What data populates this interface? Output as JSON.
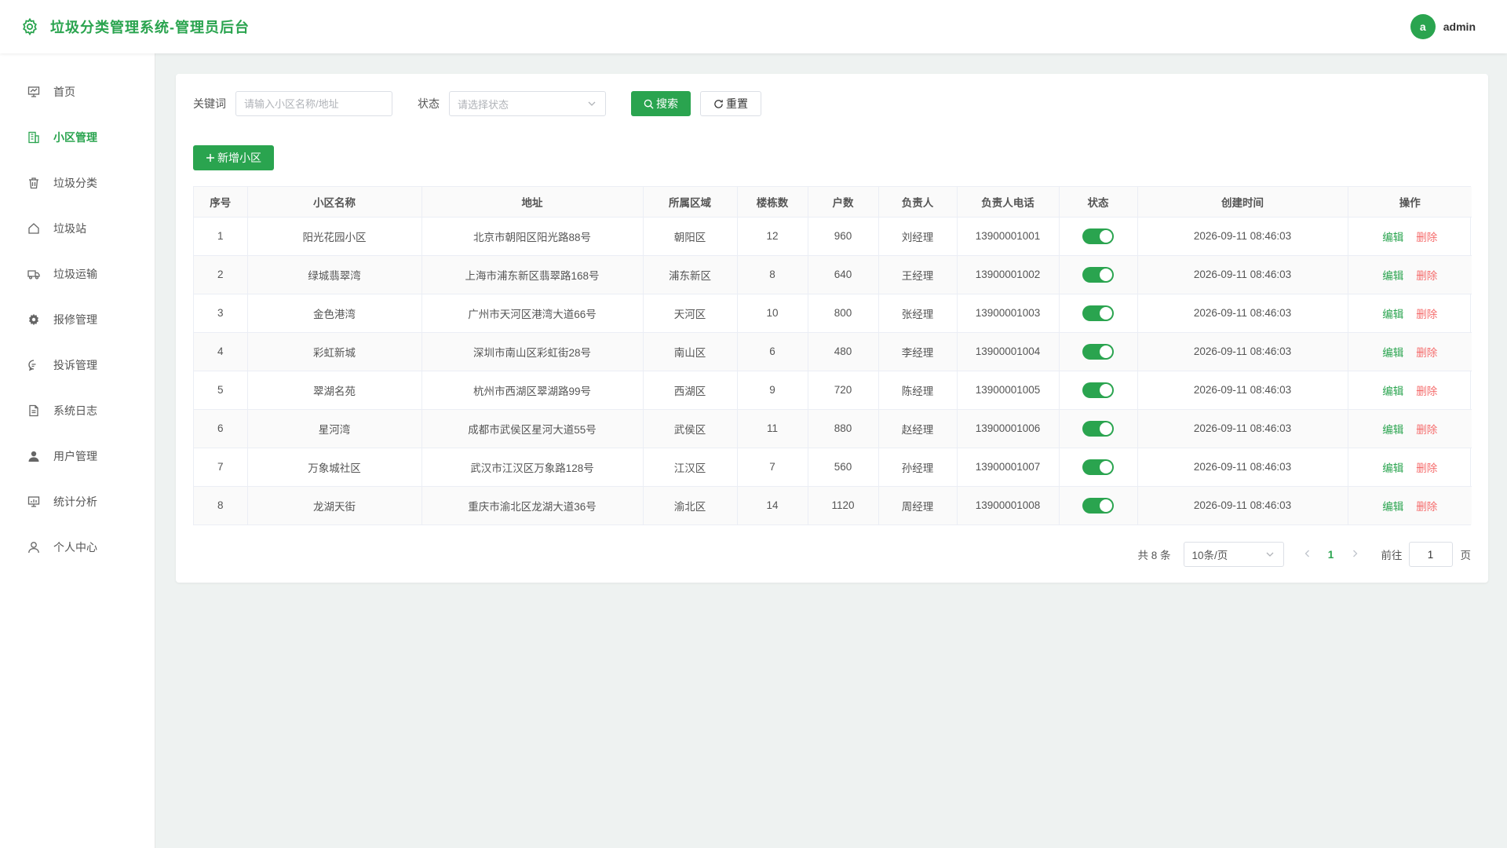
{
  "header": {
    "title": "垃圾分类管理系统-管理员后台",
    "avatar_letter": "a",
    "username": "admin"
  },
  "sidebar": {
    "items": [
      {
        "label": "首页",
        "icon": "monitor-chart-icon",
        "active": false
      },
      {
        "label": "小区管理",
        "icon": "building-icon",
        "active": true
      },
      {
        "label": "垃圾分类",
        "icon": "trash-can-icon",
        "active": false
      },
      {
        "label": "垃圾站",
        "icon": "house-icon",
        "active": false
      },
      {
        "label": "垃圾运输",
        "icon": "truck-icon",
        "active": false
      },
      {
        "label": "报修管理",
        "icon": "gear-icon",
        "active": false
      },
      {
        "label": "投诉管理",
        "icon": "chat-bubble-icon",
        "active": false
      },
      {
        "label": "系统日志",
        "icon": "document-icon",
        "active": false
      },
      {
        "label": "用户管理",
        "icon": "user-filled-icon",
        "active": false
      },
      {
        "label": "统计分析",
        "icon": "data-board-icon",
        "active": false
      },
      {
        "label": "个人中心",
        "icon": "user-outline-icon",
        "active": false
      }
    ]
  },
  "search": {
    "keyword_label": "关键词",
    "keyword_placeholder": "请输入小区名称/地址",
    "keyword_value": "",
    "status_label": "状态",
    "status_placeholder": "请选择状态",
    "search_button": "搜索",
    "reset_button": "重置"
  },
  "add_button": "新增小区",
  "table": {
    "columns": [
      "序号",
      "小区名称",
      "地址",
      "所属区域",
      "楼栋数",
      "户数",
      "负责人",
      "负责人电话",
      "状态",
      "创建时间",
      "操作"
    ],
    "edit_label": "编辑",
    "delete_label": "删除",
    "rows": [
      {
        "no": "1",
        "name": "阳光花园小区",
        "address": "北京市朝阳区阳光路88号",
        "district": "朝阳区",
        "buildings": "12",
        "households": "960",
        "manager": "刘经理",
        "phone": "13900001001",
        "status_on": true,
        "created": "2026-09-11 08:46:03"
      },
      {
        "no": "2",
        "name": "绿城翡翠湾",
        "address": "上海市浦东新区翡翠路168号",
        "district": "浦东新区",
        "buildings": "8",
        "households": "640",
        "manager": "王经理",
        "phone": "13900001002",
        "status_on": true,
        "created": "2026-09-11 08:46:03"
      },
      {
        "no": "3",
        "name": "金色港湾",
        "address": "广州市天河区港湾大道66号",
        "district": "天河区",
        "buildings": "10",
        "households": "800",
        "manager": "张经理",
        "phone": "13900001003",
        "status_on": true,
        "created": "2026-09-11 08:46:03"
      },
      {
        "no": "4",
        "name": "彩虹新城",
        "address": "深圳市南山区彩虹街28号",
        "district": "南山区",
        "buildings": "6",
        "households": "480",
        "manager": "李经理",
        "phone": "13900001004",
        "status_on": true,
        "created": "2026-09-11 08:46:03"
      },
      {
        "no": "5",
        "name": "翠湖名苑",
        "address": "杭州市西湖区翠湖路99号",
        "district": "西湖区",
        "buildings": "9",
        "households": "720",
        "manager": "陈经理",
        "phone": "13900001005",
        "status_on": true,
        "created": "2026-09-11 08:46:03"
      },
      {
        "no": "6",
        "name": "星河湾",
        "address": "成都市武侯区星河大道55号",
        "district": "武侯区",
        "buildings": "11",
        "households": "880",
        "manager": "赵经理",
        "phone": "13900001006",
        "status_on": true,
        "created": "2026-09-11 08:46:03"
      },
      {
        "no": "7",
        "name": "万象城社区",
        "address": "武汉市江汉区万象路128号",
        "district": "江汉区",
        "buildings": "7",
        "households": "560",
        "manager": "孙经理",
        "phone": "13900001007",
        "status_on": true,
        "created": "2026-09-11 08:46:03"
      },
      {
        "no": "8",
        "name": "龙湖天街",
        "address": "重庆市渝北区龙湖大道36号",
        "district": "渝北区",
        "buildings": "14",
        "households": "1120",
        "manager": "周经理",
        "phone": "13900001008",
        "status_on": true,
        "created": "2026-09-11 08:46:03"
      }
    ]
  },
  "pagination": {
    "total_text": "共 8 条",
    "page_size": "10条/页",
    "current_page": "1",
    "goto_label": "前往",
    "goto_value": "1",
    "page_suffix": "页"
  },
  "colors": {
    "primary": "#2aa44f",
    "danger": "#f56c6c"
  }
}
